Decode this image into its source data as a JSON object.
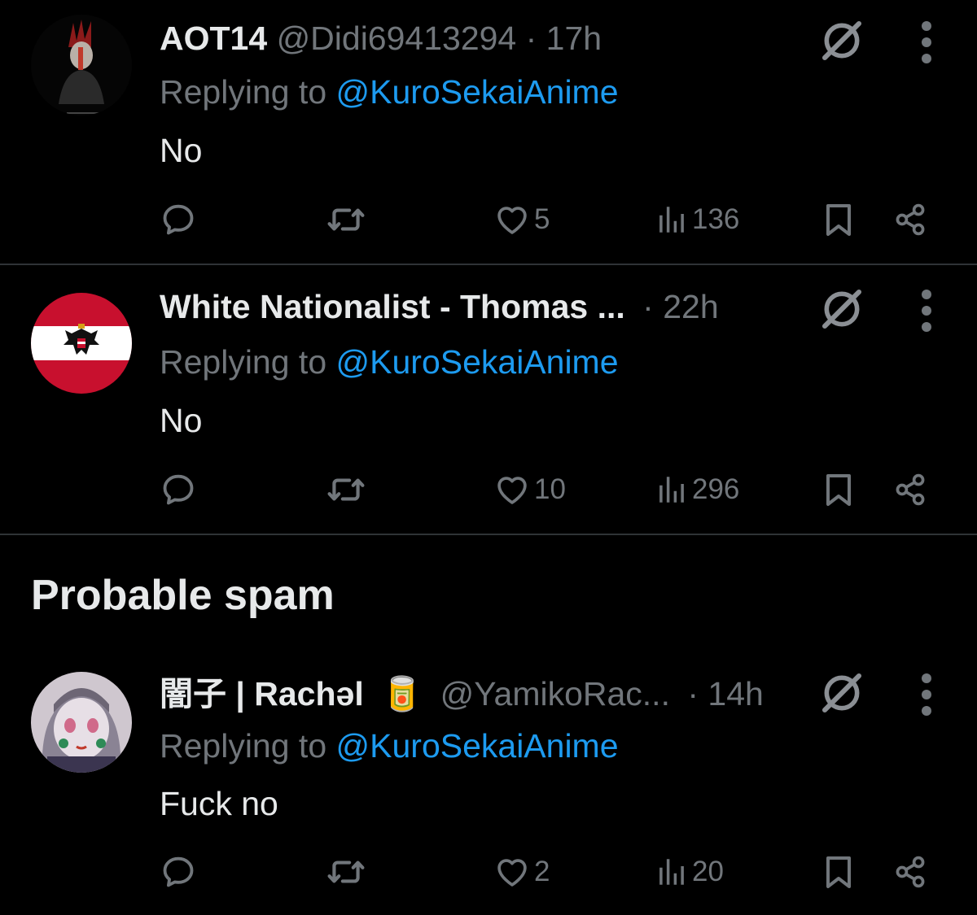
{
  "replies": [
    {
      "name": "AOT14",
      "handle": "@Didi69413294",
      "time": "· 17h",
      "replying_prefix": "Replying to ",
      "replying_to": "@KuroSekaiAnime",
      "text": "No",
      "likes": "5",
      "views": "136",
      "avatar": "dark-anime-character-avatar"
    },
    {
      "name": "White Nationalist - Thomas ...",
      "handle": "",
      "time": "· 22h",
      "replying_prefix": "Replying to ",
      "replying_to": "@KuroSekaiAnime",
      "text": "No",
      "likes": "10",
      "views": "296",
      "avatar": "austria-flag-eagle-avatar"
    },
    {
      "name": "闇子 | Rachəl",
      "name_emoji": "🥫",
      "handle": "@YamikoRac...",
      "time": "· 14h",
      "replying_prefix": "Replying to ",
      "replying_to": "@KuroSekaiAnime",
      "text": "Fuck no",
      "likes": "2",
      "views": "20",
      "avatar": "anime-girl-avatar"
    }
  ],
  "section": {
    "title": "Probable spam"
  },
  "colors": {
    "background": "#000000",
    "text": "#e7e9ea",
    "muted": "#71767b",
    "link": "#1d9bf0",
    "divider": "#2f3336"
  },
  "icons": {
    "reply": "reply-icon",
    "retweet": "retweet-icon",
    "like": "heart-icon",
    "views": "views-icon",
    "bookmark": "bookmark-icon",
    "share": "share-icon",
    "grok": "grok-icon",
    "more": "more-icon"
  }
}
